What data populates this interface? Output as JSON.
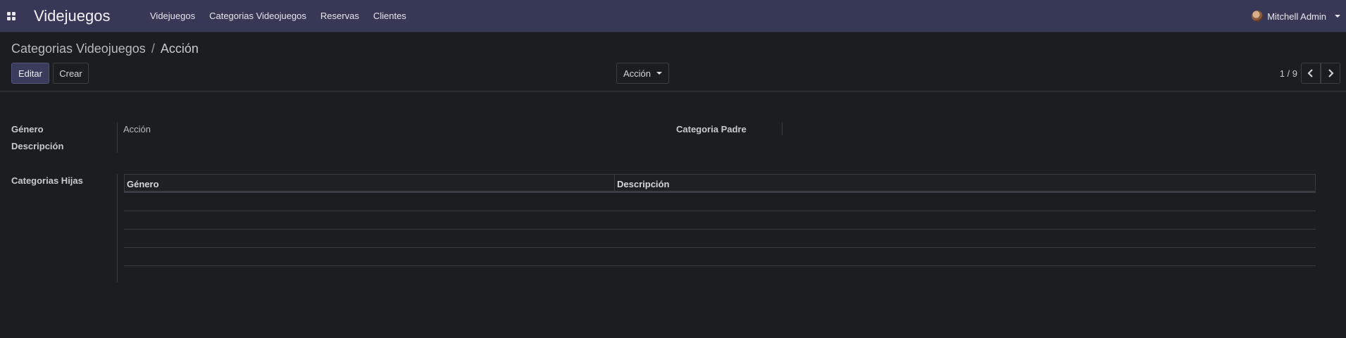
{
  "navbar": {
    "brand": "Videjuegos",
    "menu": [
      "Videjuegos",
      "Categorias Videojuegos",
      "Reservas",
      "Clientes"
    ],
    "user": "Mitchell Admin"
  },
  "breadcrumb": {
    "parent": "Categorias Videojuegos",
    "separator": "/",
    "current": "Acción"
  },
  "buttons": {
    "edit": "Editar",
    "create": "Crear",
    "action": "Acción"
  },
  "pager": {
    "text": "1 / 9"
  },
  "form": {
    "genre_label": "Género",
    "genre_value": "Acción",
    "description_label": "Descripción",
    "parent_label": "Categoria Padre",
    "children_label": "Categorias Hijas"
  },
  "subtable": {
    "columns": [
      "Género",
      "Descripción"
    ]
  }
}
